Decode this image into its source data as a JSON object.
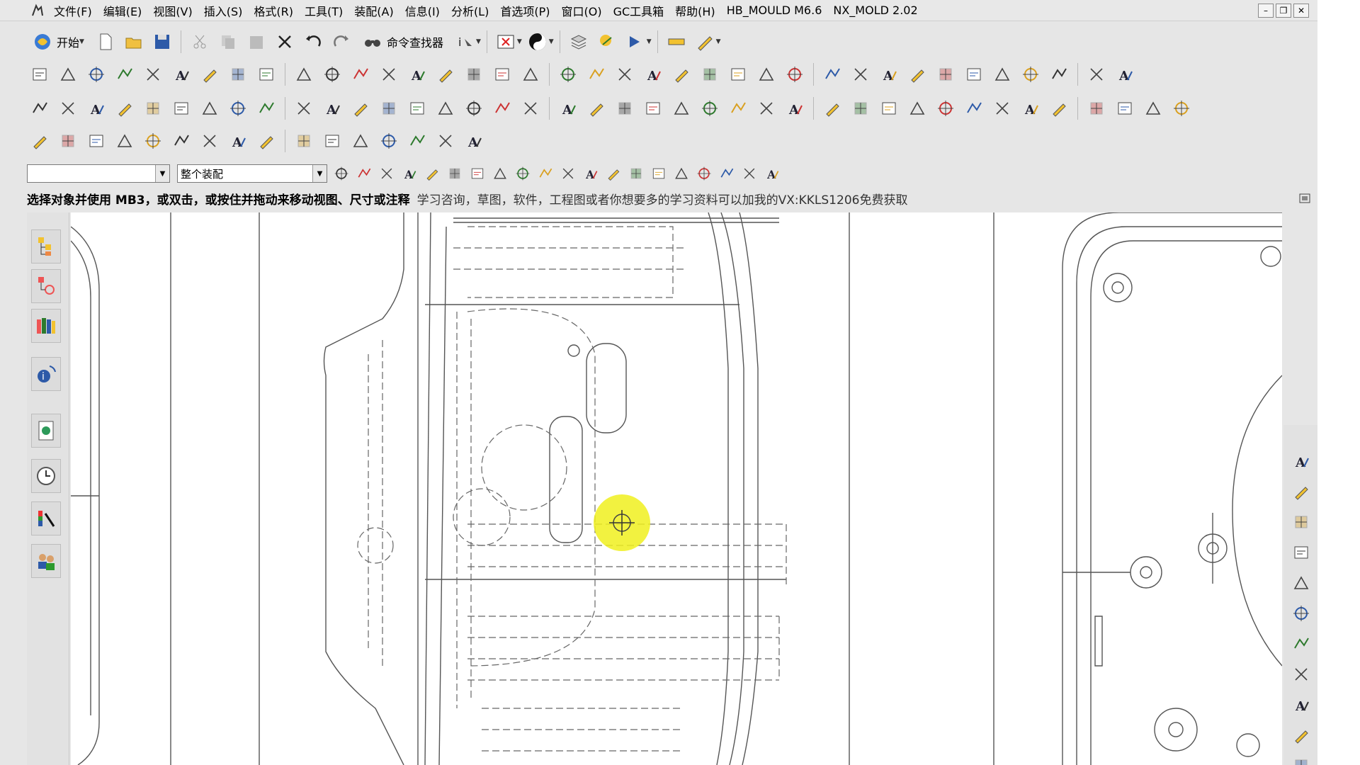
{
  "menubar": {
    "items": [
      "文件(F)",
      "编辑(E)",
      "视图(V)",
      "插入(S)",
      "格式(R)",
      "工具(T)",
      "装配(A)",
      "信息(I)",
      "分析(L)",
      "首选项(P)",
      "窗口(O)",
      "GC工具箱",
      "帮助(H)",
      "HB_MOULD M6.6",
      "NX_MOLD 2.02"
    ]
  },
  "toolbar": {
    "start_label": "开始",
    "command_finder_label": "命令查找器"
  },
  "selection_bar": {
    "filter_value": "",
    "scope_value": "整个装配"
  },
  "cue_line": {
    "prompt": "选择对象并使用 MB3，或双击，或按住并拖动来移动视图、尺寸或注释",
    "message": "学习咨询，草图，软件，工程图或者你想要多的学习资料可以加我的VX:KKLS1206免费获取"
  },
  "window_buttons": {
    "minimize": "–",
    "restore": "❐",
    "close": "✕"
  },
  "colors": {
    "background": "#e6e6e6",
    "graphics_bg": "#ffffff",
    "drawing_line": "#555555",
    "cursor_highlight": "#f0f01e"
  }
}
